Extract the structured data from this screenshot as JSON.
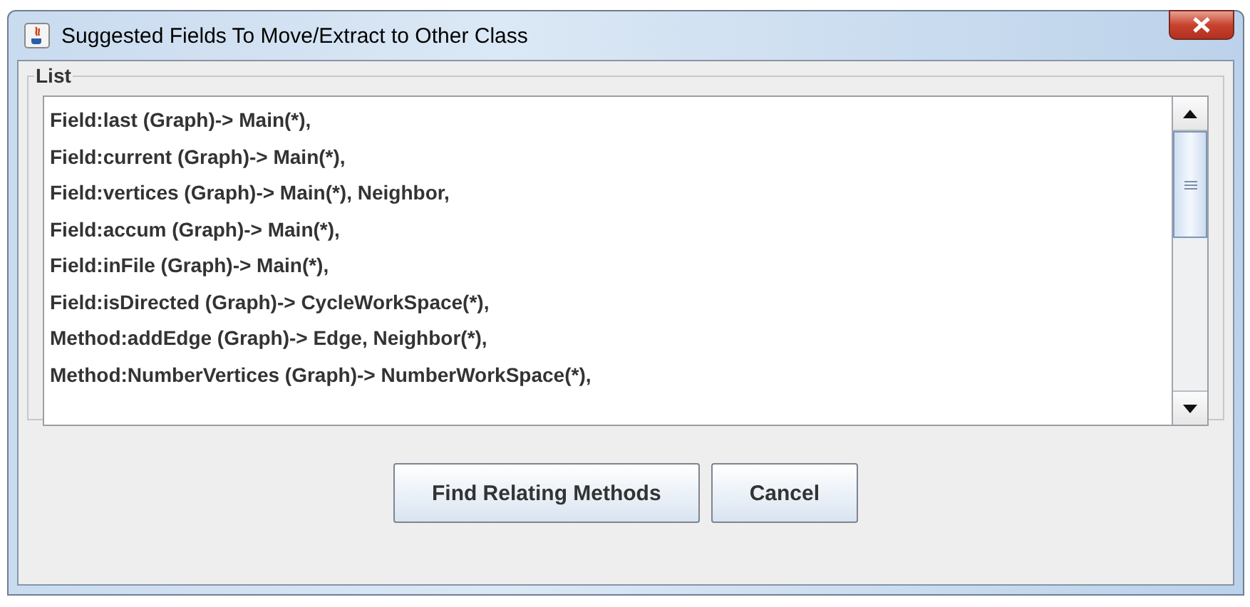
{
  "window": {
    "title": "Suggested Fields To Move/Extract to Other Class"
  },
  "group": {
    "title": "List"
  },
  "list": {
    "items": [
      "Field:last (Graph)-> Main(*),",
      "Field:current (Graph)-> Main(*),",
      "Field:vertices (Graph)-> Main(*), Neighbor,",
      "Field:accum (Graph)-> Main(*),",
      "Field:inFile (Graph)-> Main(*),",
      "Field:isDirected (Graph)-> CycleWorkSpace(*),",
      "Method:addEdge (Graph)-> Edge, Neighbor(*),",
      "Method:NumberVertices (Graph)-> NumberWorkSpace(*),"
    ]
  },
  "buttons": [
    "Find Relating Methods",
    "Cancel"
  ]
}
